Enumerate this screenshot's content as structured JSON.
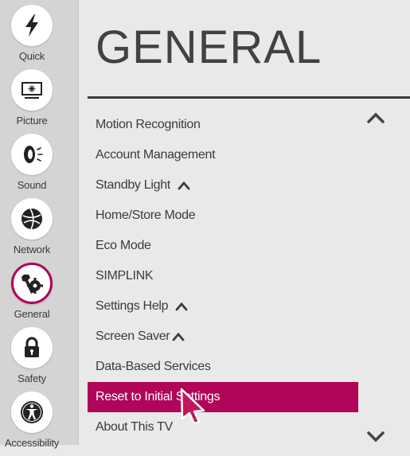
{
  "sidebar": {
    "items": [
      {
        "label": "Quick",
        "icon": "lightning-icon"
      },
      {
        "label": "Picture",
        "icon": "tv-screen-icon"
      },
      {
        "label": "Sound",
        "icon": "speaker-icon"
      },
      {
        "label": "Network",
        "icon": "globe-icon"
      },
      {
        "label": "General",
        "icon": "wrench-gear-icon",
        "active": true
      },
      {
        "label": "Safety",
        "icon": "lock-icon"
      },
      {
        "label": "Accessibility",
        "icon": "accessibility-person-icon"
      }
    ]
  },
  "main": {
    "title": "GENERAL",
    "menu": [
      {
        "label": "Motion Recognition"
      },
      {
        "label": "Account Management"
      },
      {
        "label": "Standby Light",
        "caret": true
      },
      {
        "label": "Home/Store Mode"
      },
      {
        "label": "Eco Mode"
      },
      {
        "label": "SIMPLINK"
      },
      {
        "label": "Settings Help",
        "caret": true
      },
      {
        "label": "Screen Saver",
        "caret": true
      },
      {
        "label": "Data-Based Services"
      },
      {
        "label": "Reset to Initial Settings",
        "selected": true
      },
      {
        "label": "About This TV"
      }
    ]
  },
  "colors": {
    "accent": "#b00559",
    "sidebar_bg": "#d4d4d4",
    "main_bg": "#e9e9e9",
    "text": "#3c3c3c"
  }
}
